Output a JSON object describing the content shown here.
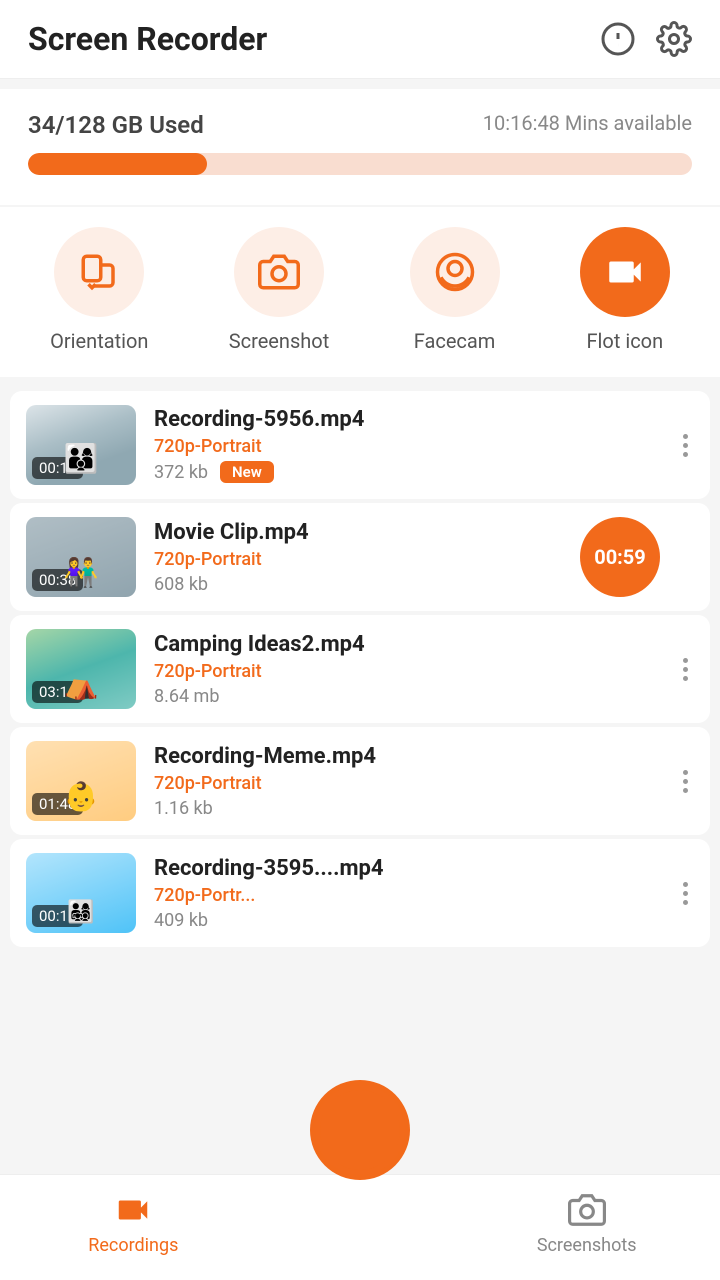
{
  "header": {
    "title": "Screen Recorder",
    "alert_icon": "alert-circle-icon",
    "settings_icon": "settings-icon"
  },
  "storage": {
    "used_label": "34/128 GB Used",
    "available_label": "10:16:48 Mins available",
    "fill_percent": 27
  },
  "quick_actions": [
    {
      "id": "orientation",
      "label": "Orientation",
      "active": false
    },
    {
      "id": "screenshot",
      "label": "Screenshot",
      "active": false
    },
    {
      "id": "facecam",
      "label": "Facecam",
      "active": false
    },
    {
      "id": "flot_icon",
      "label": "Flot icon",
      "active": true
    }
  ],
  "recordings": [
    {
      "name": "Recording-5956.mp4",
      "resolution": "720p-Portrait",
      "size": "372 kb",
      "duration": "00:16",
      "is_new": true,
      "new_label": "New",
      "thumb_class": "thumb-person-1",
      "has_timer": false
    },
    {
      "name": "Movie Clip.mp4",
      "resolution": "720p-Portrait",
      "size": "608 kb",
      "duration": "00:38",
      "is_new": false,
      "new_label": "",
      "thumb_class": "thumb-couple",
      "has_timer": true,
      "timer_value": "00:59"
    },
    {
      "name": "Camping Ideas2.mp4",
      "resolution": "720p-Portrait",
      "size": "8.64 mb",
      "duration": "03:16",
      "is_new": false,
      "new_label": "",
      "thumb_class": "thumb-camping",
      "has_timer": false
    },
    {
      "name": "Recording-Meme.mp4",
      "resolution": "720p-Portrait",
      "size": "1.16 kb",
      "duration": "01:48",
      "is_new": false,
      "new_label": "",
      "thumb_class": "thumb-meme",
      "has_timer": false
    },
    {
      "name": "Recording-3595....mp4",
      "resolution": "720p-Portr...",
      "size": "409 kb",
      "duration": "00:16",
      "is_new": false,
      "new_label": "",
      "thumb_class": "thumb-family",
      "has_timer": false
    }
  ],
  "bottom_nav": {
    "recordings_label": "Recordings",
    "screenshots_label": "Screenshots"
  }
}
